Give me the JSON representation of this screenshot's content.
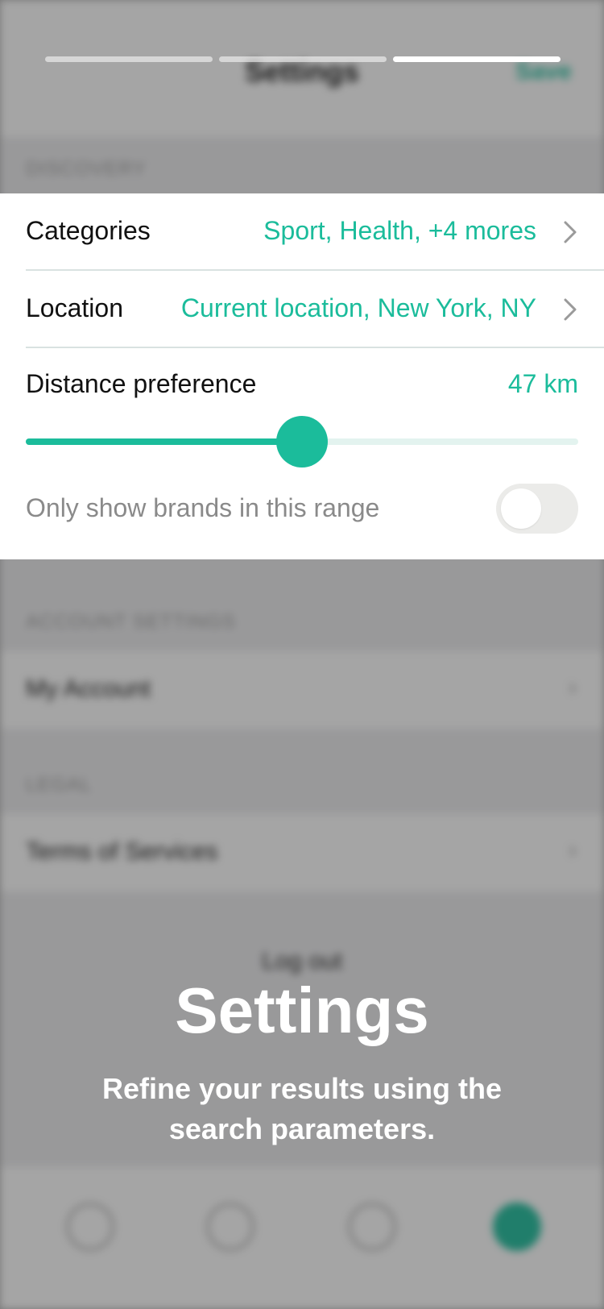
{
  "background": {
    "title": "Settings",
    "save_label": "Save",
    "section_discovery": "DISCOVERY",
    "section_account": "ACCOUNT SETTINGS",
    "my_account": "My Account",
    "section_legal": "LEGAL",
    "terms": "Terms of Services",
    "logout": "Log out",
    "tabs": [
      {
        "icon": "home-icon"
      },
      {
        "icon": "heart-icon"
      },
      {
        "icon": "smile-icon"
      },
      {
        "icon": "settings-icon",
        "active": true
      }
    ]
  },
  "story": {
    "total_steps": 3,
    "current_step": 3
  },
  "card": {
    "categories_label": "Categories",
    "categories_value": "Sport, Health, +4 mores",
    "location_label": "Location",
    "location_value": "Current location, New York, NY",
    "distance_label": "Distance preference",
    "distance_value": "47 km",
    "distance_fraction": 0.5,
    "range_label": "Only show brands in this range",
    "range_toggle_on": false
  },
  "caption": {
    "title": "Settings",
    "text": "Refine your results using the search parameters."
  },
  "colors": {
    "accent": "#1bbc9b",
    "toggle_off": "#ebebe9",
    "overlay": "rgba(40,40,40,0.42)"
  }
}
